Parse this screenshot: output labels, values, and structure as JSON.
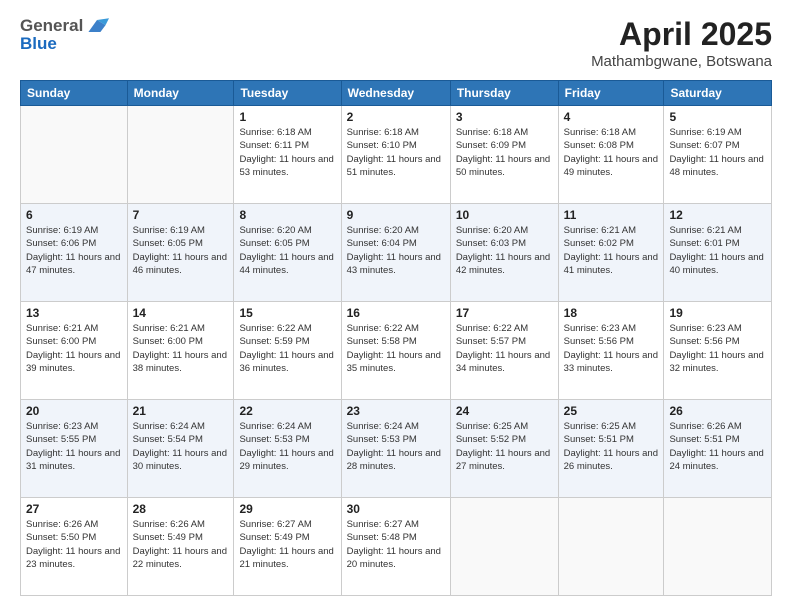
{
  "header": {
    "logo_line1": "General",
    "logo_line2": "Blue",
    "month_year": "April 2025",
    "location": "Mathambgwane, Botswana"
  },
  "days_of_week": [
    "Sunday",
    "Monday",
    "Tuesday",
    "Wednesday",
    "Thursday",
    "Friday",
    "Saturday"
  ],
  "weeks": [
    [
      {
        "day": "",
        "detail": ""
      },
      {
        "day": "",
        "detail": ""
      },
      {
        "day": "1",
        "detail": "Sunrise: 6:18 AM\nSunset: 6:11 PM\nDaylight: 11 hours and 53 minutes."
      },
      {
        "day": "2",
        "detail": "Sunrise: 6:18 AM\nSunset: 6:10 PM\nDaylight: 11 hours and 51 minutes."
      },
      {
        "day": "3",
        "detail": "Sunrise: 6:18 AM\nSunset: 6:09 PM\nDaylight: 11 hours and 50 minutes."
      },
      {
        "day": "4",
        "detail": "Sunrise: 6:18 AM\nSunset: 6:08 PM\nDaylight: 11 hours and 49 minutes."
      },
      {
        "day": "5",
        "detail": "Sunrise: 6:19 AM\nSunset: 6:07 PM\nDaylight: 11 hours and 48 minutes."
      }
    ],
    [
      {
        "day": "6",
        "detail": "Sunrise: 6:19 AM\nSunset: 6:06 PM\nDaylight: 11 hours and 47 minutes."
      },
      {
        "day": "7",
        "detail": "Sunrise: 6:19 AM\nSunset: 6:05 PM\nDaylight: 11 hours and 46 minutes."
      },
      {
        "day": "8",
        "detail": "Sunrise: 6:20 AM\nSunset: 6:05 PM\nDaylight: 11 hours and 44 minutes."
      },
      {
        "day": "9",
        "detail": "Sunrise: 6:20 AM\nSunset: 6:04 PM\nDaylight: 11 hours and 43 minutes."
      },
      {
        "day": "10",
        "detail": "Sunrise: 6:20 AM\nSunset: 6:03 PM\nDaylight: 11 hours and 42 minutes."
      },
      {
        "day": "11",
        "detail": "Sunrise: 6:21 AM\nSunset: 6:02 PM\nDaylight: 11 hours and 41 minutes."
      },
      {
        "day": "12",
        "detail": "Sunrise: 6:21 AM\nSunset: 6:01 PM\nDaylight: 11 hours and 40 minutes."
      }
    ],
    [
      {
        "day": "13",
        "detail": "Sunrise: 6:21 AM\nSunset: 6:00 PM\nDaylight: 11 hours and 39 minutes."
      },
      {
        "day": "14",
        "detail": "Sunrise: 6:21 AM\nSunset: 6:00 PM\nDaylight: 11 hours and 38 minutes."
      },
      {
        "day": "15",
        "detail": "Sunrise: 6:22 AM\nSunset: 5:59 PM\nDaylight: 11 hours and 36 minutes."
      },
      {
        "day": "16",
        "detail": "Sunrise: 6:22 AM\nSunset: 5:58 PM\nDaylight: 11 hours and 35 minutes."
      },
      {
        "day": "17",
        "detail": "Sunrise: 6:22 AM\nSunset: 5:57 PM\nDaylight: 11 hours and 34 minutes."
      },
      {
        "day": "18",
        "detail": "Sunrise: 6:23 AM\nSunset: 5:56 PM\nDaylight: 11 hours and 33 minutes."
      },
      {
        "day": "19",
        "detail": "Sunrise: 6:23 AM\nSunset: 5:56 PM\nDaylight: 11 hours and 32 minutes."
      }
    ],
    [
      {
        "day": "20",
        "detail": "Sunrise: 6:23 AM\nSunset: 5:55 PM\nDaylight: 11 hours and 31 minutes."
      },
      {
        "day": "21",
        "detail": "Sunrise: 6:24 AM\nSunset: 5:54 PM\nDaylight: 11 hours and 30 minutes."
      },
      {
        "day": "22",
        "detail": "Sunrise: 6:24 AM\nSunset: 5:53 PM\nDaylight: 11 hours and 29 minutes."
      },
      {
        "day": "23",
        "detail": "Sunrise: 6:24 AM\nSunset: 5:53 PM\nDaylight: 11 hours and 28 minutes."
      },
      {
        "day": "24",
        "detail": "Sunrise: 6:25 AM\nSunset: 5:52 PM\nDaylight: 11 hours and 27 minutes."
      },
      {
        "day": "25",
        "detail": "Sunrise: 6:25 AM\nSunset: 5:51 PM\nDaylight: 11 hours and 26 minutes."
      },
      {
        "day": "26",
        "detail": "Sunrise: 6:26 AM\nSunset: 5:51 PM\nDaylight: 11 hours and 24 minutes."
      }
    ],
    [
      {
        "day": "27",
        "detail": "Sunrise: 6:26 AM\nSunset: 5:50 PM\nDaylight: 11 hours and 23 minutes."
      },
      {
        "day": "28",
        "detail": "Sunrise: 6:26 AM\nSunset: 5:49 PM\nDaylight: 11 hours and 22 minutes."
      },
      {
        "day": "29",
        "detail": "Sunrise: 6:27 AM\nSunset: 5:49 PM\nDaylight: 11 hours and 21 minutes."
      },
      {
        "day": "30",
        "detail": "Sunrise: 6:27 AM\nSunset: 5:48 PM\nDaylight: 11 hours and 20 minutes."
      },
      {
        "day": "",
        "detail": ""
      },
      {
        "day": "",
        "detail": ""
      },
      {
        "day": "",
        "detail": ""
      }
    ]
  ]
}
